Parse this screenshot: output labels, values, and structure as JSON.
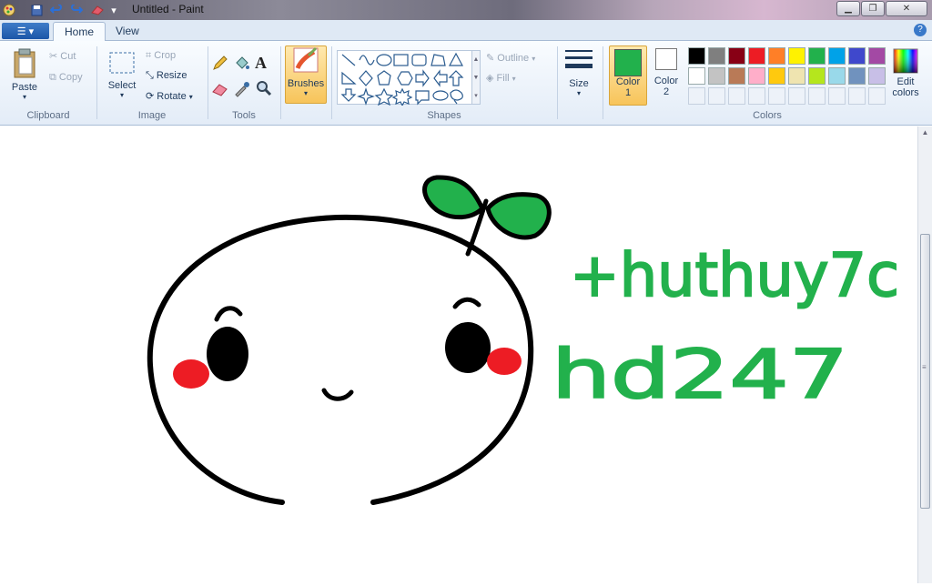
{
  "window": {
    "title": "Untitled - Paint"
  },
  "tabs": {
    "home": "Home",
    "view": "View"
  },
  "clipboard": {
    "label": "Clipboard",
    "paste": "Paste",
    "cut": "Cut",
    "copy": "Copy"
  },
  "image": {
    "label": "Image",
    "select": "Select",
    "crop": "Crop",
    "resize": "Resize",
    "rotate": "Rotate"
  },
  "tools": {
    "label": "Tools"
  },
  "brushes": {
    "label": "Brushes"
  },
  "shapes": {
    "label": "Shapes",
    "outline": "Outline",
    "fill": "Fill"
  },
  "size": {
    "label": "Size"
  },
  "colors": {
    "label": "Colors",
    "color1_line1": "Color",
    "color1_line2": "1",
    "color2_line1": "Color",
    "color2_line2": "2",
    "edit_line1": "Edit",
    "edit_line2": "colors",
    "color1_value": "#22b14c",
    "color2_value": "#ffffff",
    "palette_row1": [
      "#000000",
      "#7f7f7f",
      "#880015",
      "#ed1c24",
      "#ff7f27",
      "#fff200",
      "#22b14c",
      "#00a2e8",
      "#3f48cc",
      "#a349a4"
    ],
    "palette_row2": [
      "#ffffff",
      "#c3c3c3",
      "#b97a57",
      "#ffaec9",
      "#ffc90e",
      "#efe4b0",
      "#b5e61d",
      "#99d9ea",
      "#7092be",
      "#c8bfe7"
    ]
  },
  "drawing": {
    "text_line1": "+huthuy7c",
    "text_line2": "hd247"
  }
}
